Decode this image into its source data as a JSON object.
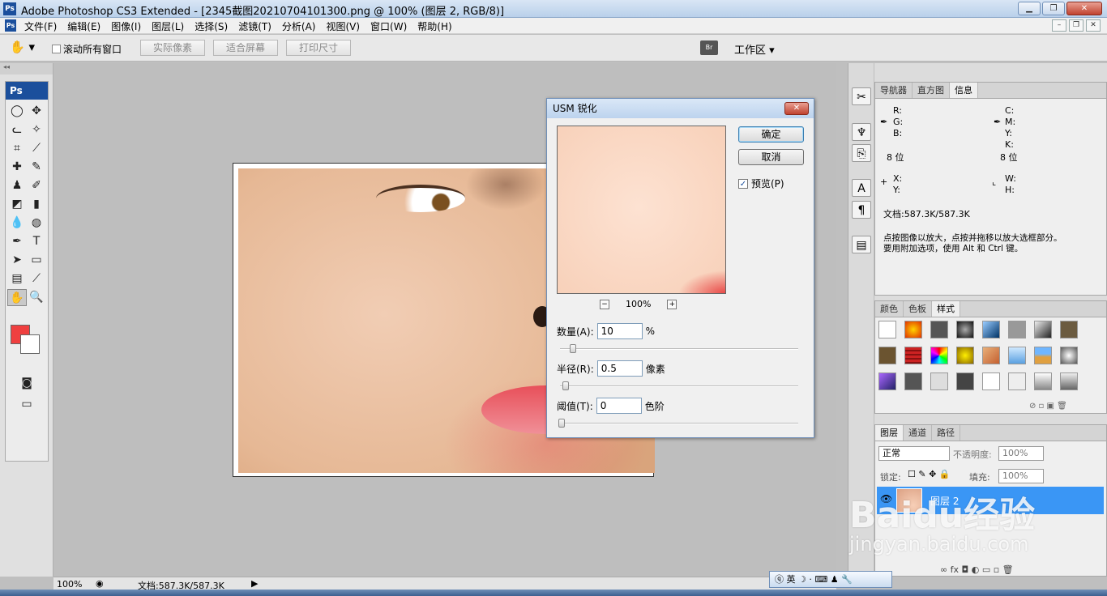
{
  "window": {
    "app_logo": "Ps",
    "title": "Adobe Photoshop CS3 Extended - [2345截图20210704101300.png @ 100% (图层 2, RGB/8)]",
    "min": "▁",
    "max": "❐",
    "close": "✕"
  },
  "menu": {
    "logo": "Ps",
    "items": [
      "文件(F)",
      "编辑(E)",
      "图像(I)",
      "图层(L)",
      "选择(S)",
      "滤镜(T)",
      "分析(A)",
      "视图(V)",
      "窗口(W)",
      "帮助(H)"
    ],
    "doc_min": "–",
    "doc_restore": "❐",
    "doc_close": "✕"
  },
  "options": {
    "scroll_all_label": "滚动所有窗口",
    "actual_pixels": "实际像素",
    "fit_screen": "适合屏幕",
    "print_size": "打印尺寸",
    "bridge_label": "Br",
    "workspace_label": "工作区 ▾"
  },
  "toolbox": {
    "header": "Ps",
    "foreground_color": "#ef3f3f",
    "background_color": "#ffffff"
  },
  "dialog": {
    "title": "USM 锐化",
    "close": "✕",
    "ok": "确定",
    "cancel": "取消",
    "preview_label": "预览(P)",
    "preview_checked": true,
    "zoom": "100%",
    "zoom_out": "−",
    "zoom_in": "+",
    "amount_label": "数量(A):",
    "amount_value": "10",
    "amount_unit": "%",
    "radius_label": "半径(R):",
    "radius_value": "0.5",
    "radius_unit": "像素",
    "threshold_label": "阈值(T):",
    "threshold_value": "0",
    "threshold_unit": "色阶"
  },
  "info_panel": {
    "tabs": [
      "导航器",
      "直方图",
      "信息"
    ],
    "active_tab": "信息",
    "r": "R:",
    "g": "G:",
    "b": "B:",
    "c": "C:",
    "m": "M:",
    "y": "Y:",
    "k": "K:",
    "bits_left": "8 位",
    "bits_right": "8 位",
    "x": "X:",
    "y_coord": "Y:",
    "w": "W:",
    "h": "H:",
    "doc": "文档:587.3K/587.3K",
    "hint_line1": "点按图像以放大，点按并拖移以放大选框部分。",
    "hint_line2": "要用附加选项，使用 Alt 和 Ctrl 键。"
  },
  "styles_panel": {
    "tabs": [
      "颜色",
      "色板",
      "样式"
    ],
    "active_tab": "样式"
  },
  "layers_panel": {
    "tabs": [
      "图层",
      "通道",
      "路径"
    ],
    "active_tab": "图层",
    "blend_mode": "正常",
    "opacity_label": "不透明度:",
    "opacity_value": "100%",
    "lock_label": "锁定:",
    "fill_label": "填充:",
    "fill_value": "100%",
    "layer_name": "图层 2"
  },
  "status": {
    "zoom": "100%",
    "doc": "文档:587.3K/587.3K"
  },
  "ime": {
    "label": "英"
  },
  "watermark": {
    "main": "Baidu经验",
    "sub": "jingyan.baidu.com"
  }
}
